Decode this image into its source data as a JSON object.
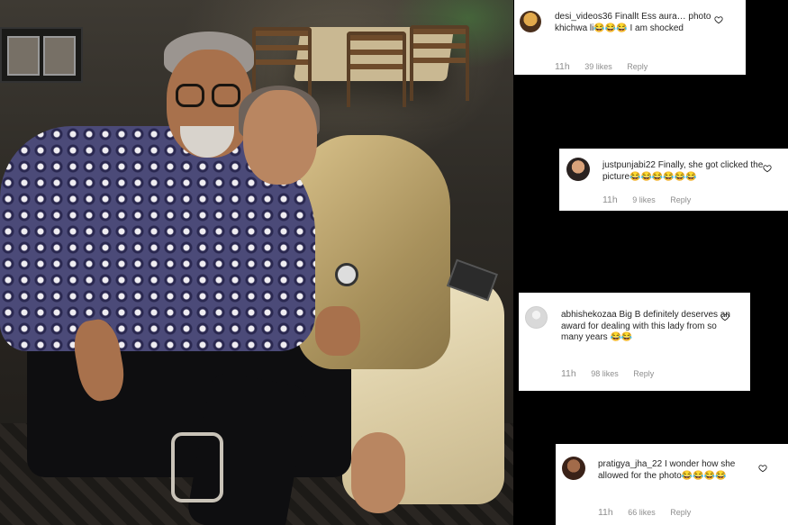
{
  "comments": [
    {
      "username": "desi_videos36",
      "text": "Finallt Ess aura… photo khichwa li😂😂😂 I am shocked",
      "time": "11h",
      "likes": "39 likes",
      "reply": "Reply"
    },
    {
      "username": "justpunjabi22",
      "text": "Finally, she got clicked the picture😂😂😂😂😂😂",
      "time": "11h",
      "likes": "9 likes",
      "reply": "Reply"
    },
    {
      "username": "abhishekozaa",
      "text": "Big B definitely deserves an award for dealing with this lady from so many years 😂😂",
      "time": "11h",
      "likes": "98 likes",
      "reply": "Reply"
    },
    {
      "username": "pratigya_jha_22",
      "text": "I wonder how she allowed for the photo😂😂😂😂",
      "time": "11h",
      "likes": "66 likes",
      "reply": "Reply"
    }
  ],
  "icons": {
    "like": "heart-outline-icon"
  },
  "colors": {
    "background": "#000000",
    "card": "#ffffff",
    "text": "#262626",
    "meta": "#8e8e8e"
  }
}
